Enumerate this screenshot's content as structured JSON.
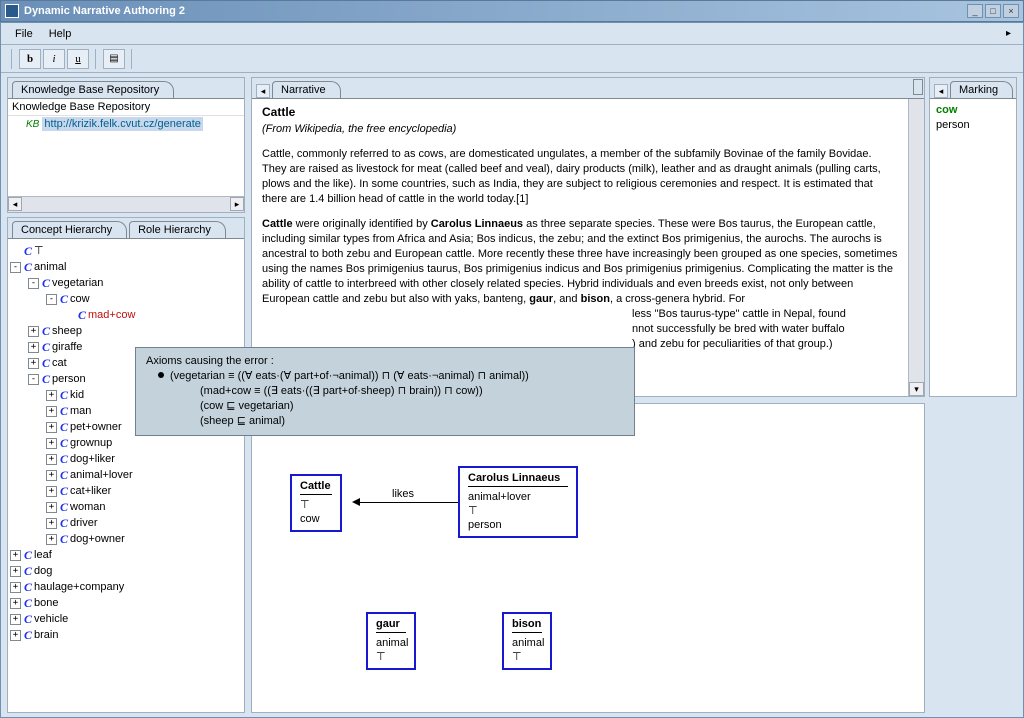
{
  "titlebar": {
    "title": "Dynamic Narrative Authoring 2"
  },
  "menu": {
    "file": "File",
    "help": "Help"
  },
  "toolbar": {
    "bold": "b",
    "italic": "i",
    "underline": "u",
    "save": "▤"
  },
  "repo": {
    "tab": "Knowledge Base Repository",
    "heading": "Knowledge Base Repository",
    "kb_prefix": "KB",
    "kb_url": "http://krizik.felk.cvut.cz/generate"
  },
  "concept": {
    "tab1": "Concept Hierarchy",
    "tab2": "Role Hierarchy",
    "tree": [
      {
        "d": 0,
        "exp": null,
        "label": "⊤"
      },
      {
        "d": 0,
        "exp": "-",
        "label": "animal"
      },
      {
        "d": 1,
        "exp": "-",
        "label": "vegetarian"
      },
      {
        "d": 2,
        "exp": "-",
        "label": "cow"
      },
      {
        "d": 3,
        "exp": null,
        "label": "mad+cow",
        "red": true
      },
      {
        "d": 1,
        "exp": "+",
        "label": "sheep"
      },
      {
        "d": 1,
        "exp": "+",
        "label": "giraffe"
      },
      {
        "d": 1,
        "exp": "+",
        "label": "cat"
      },
      {
        "d": 1,
        "exp": "-",
        "label": "person"
      },
      {
        "d": 2,
        "exp": "+",
        "label": "kid"
      },
      {
        "d": 2,
        "exp": "+",
        "label": "man"
      },
      {
        "d": 2,
        "exp": "+",
        "label": "pet+owner"
      },
      {
        "d": 2,
        "exp": "+",
        "label": "grownup"
      },
      {
        "d": 2,
        "exp": "+",
        "label": "dog+liker"
      },
      {
        "d": 2,
        "exp": "+",
        "label": "animal+lover"
      },
      {
        "d": 2,
        "exp": "+",
        "label": "cat+liker"
      },
      {
        "d": 2,
        "exp": "+",
        "label": "woman"
      },
      {
        "d": 2,
        "exp": "+",
        "label": "driver"
      },
      {
        "d": 2,
        "exp": "+",
        "label": "dog+owner"
      },
      {
        "d": 0,
        "exp": "+",
        "label": "leaf"
      },
      {
        "d": 0,
        "exp": "+",
        "label": "dog"
      },
      {
        "d": 0,
        "exp": "+",
        "label": "haulage+company"
      },
      {
        "d": 0,
        "exp": "+",
        "label": "bone"
      },
      {
        "d": 0,
        "exp": "+",
        "label": "vehicle"
      },
      {
        "d": 0,
        "exp": "+",
        "label": "brain"
      }
    ]
  },
  "narrative": {
    "tab": "Narrative",
    "title": "Cattle",
    "source": "(From Wikipedia, the free encyclopedia)",
    "p1": "Cattle, commonly referred to as cows, are domesticated ungulates, a member of the subfamily Bovinae of the family Bovidae. They are raised as livestock for meat (called beef and veal), dairy products (milk), leather and as draught animals (pulling carts, plows and the like). In some countries, such as India, they are subject to religious ceremonies and respect. It is estimated that there are 1.4 billion head of cattle in the world today.[1]",
    "p2_a": "Cattle",
    "p2_b": " were originally identified by ",
    "p2_c": "Carolus Linnaeus",
    "p2_d": " as three separate species. These were Bos taurus, the European cattle, including similar types from Africa and Asia; Bos indicus, the zebu; and the extinct Bos primigenius, the aurochs. The aurochs is ancestral to both zebu and European cattle. More recently these three have increasingly been grouped as one species, sometimes using the names Bos primigenius taurus, Bos primigenius indicus and Bos primigenius primigenius. Complicating the matter is the ability of cattle to interbreed with other closely related species. Hybrid individuals and even breeds exist, not only between European cattle and zebu but also with yaks, banteng, ",
    "p2_e": "gaur",
    "p2_f": ", and ",
    "p2_g": "bison",
    "p2_h": ", a cross-genera hybrid. For",
    "p2_frag1": "less \"Bos taurus-type\" cattle in Nepal, found",
    "p2_frag2": "nnot successfully be bred with water buffalo",
    "p2_frag3": ") and zebu for peculiarities of that group.)"
  },
  "marking": {
    "tab": "Marking",
    "items": [
      {
        "label": "cow",
        "green": true
      },
      {
        "label": "person",
        "green": false
      }
    ]
  },
  "tooltip": {
    "heading": "Axioms causing the error :",
    "l1": "(vegetarian ≡ ((∀ eats·(∀ part+of·¬animal)) ⊓ (∀ eats·¬animal) ⊓ animal))",
    "l2": "(mad+cow ≡ ((∃ eats·((∃ part+of·sheep) ⊓ brain)) ⊓ cow))",
    "l3": "(cow ⊑ vegetarian)",
    "l4": "(sheep ⊑ animal)"
  },
  "graph": {
    "cattle": {
      "title": "Cattle",
      "l1": "⊤",
      "l2": "cow"
    },
    "linnaeus": {
      "title": "Carolus Linnaeus",
      "l1": "animal+lover",
      "l2": "⊤",
      "l3": "person"
    },
    "gaur": {
      "title": "gaur",
      "l1": "animal",
      "l2": "⊤"
    },
    "bison": {
      "title": "bison",
      "l1": "animal",
      "l2": "⊤"
    },
    "edge_label": "likes"
  }
}
